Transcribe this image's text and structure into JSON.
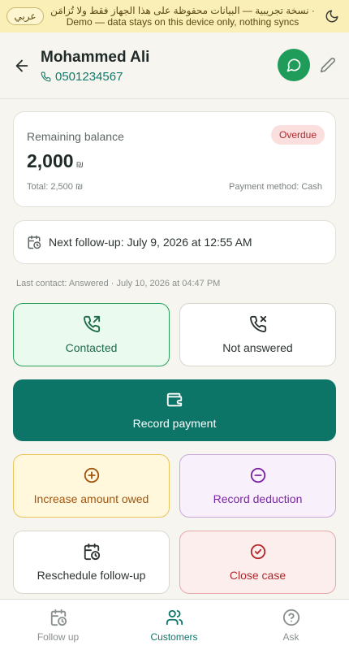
{
  "banner": {
    "text_ar": "· نسخة تجريبية — البيانات محفوظة على هذا الجهاز فقط ولا تُزامَن",
    "text_en": "Demo — data stays on this device only, nothing syncs",
    "lang_button": "عربي"
  },
  "customer": {
    "name": "Mohammed Ali",
    "phone": "0501234567"
  },
  "balance": {
    "label": "Remaining balance",
    "amount": "2,000",
    "currency": "₪",
    "status": "Overdue",
    "total": "Total: 2,500 ₪",
    "method": "Payment method: Cash"
  },
  "followup": {
    "text": "Next follow-up: July 9, 2026 at 12:55 AM"
  },
  "last_contact": "Last contact: Answered · July 10, 2026 at 04:47 PM",
  "actions": {
    "contacted": "Contacted",
    "not_answered": "Not answered",
    "record_payment": "Record payment",
    "increase": "Increase amount owed",
    "deduction": "Record deduction",
    "reschedule": "Reschedule follow-up",
    "close": "Close case"
  },
  "nav": {
    "follow_up": "Follow up",
    "customers": "Customers",
    "ask": "Ask"
  },
  "colors": {
    "primary": "#0d7568",
    "whatsapp": "#1f9c5a",
    "overdue": "#b2282b",
    "banner": "#fbefb8"
  }
}
